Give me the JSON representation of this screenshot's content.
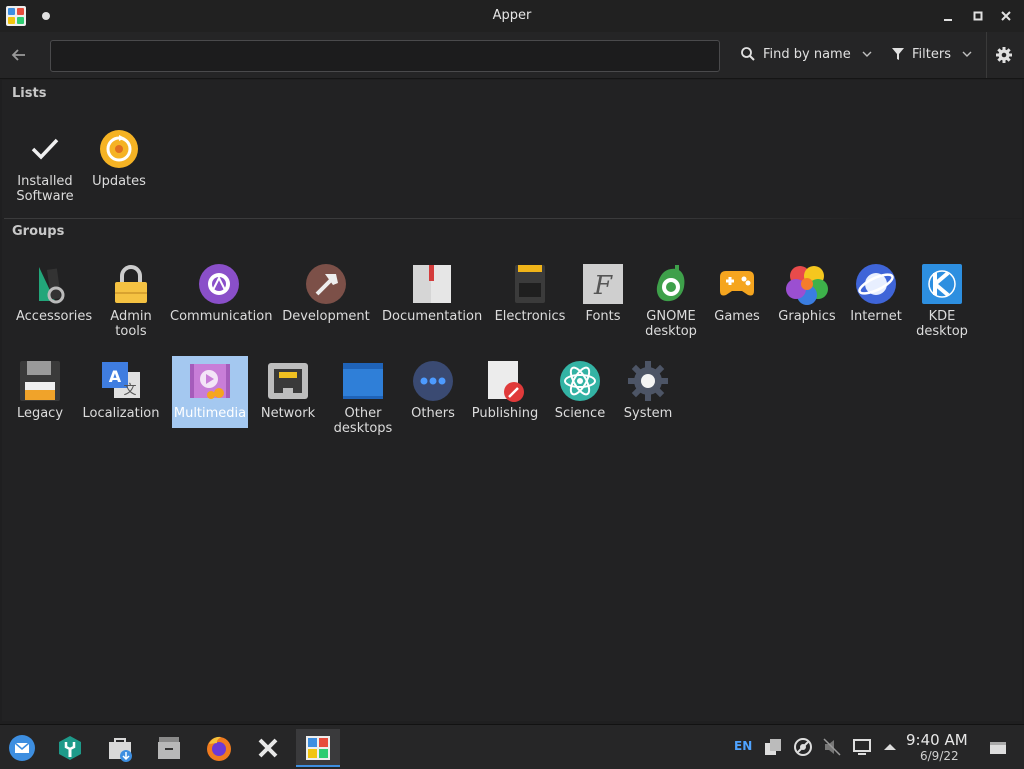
{
  "window": {
    "title": "Apper"
  },
  "toolbar": {
    "search_value": "",
    "find_by_label": "Find by name",
    "filters_label": "Filters"
  },
  "lists": {
    "title": "Lists",
    "items": [
      {
        "label": "Installed\nSoftware",
        "icon": "checkmark-icon"
      },
      {
        "label": "Updates",
        "icon": "updates-icon"
      }
    ]
  },
  "groups": {
    "title": "Groups",
    "items": [
      {
        "label": "Accessories",
        "icon": "accessories-icon"
      },
      {
        "label": "Admin\ntools",
        "icon": "lock-icon"
      },
      {
        "label": "Communication",
        "icon": "communication-icon"
      },
      {
        "label": "Development",
        "icon": "hammer-icon"
      },
      {
        "label": "Documentation",
        "icon": "book-icon"
      },
      {
        "label": "Electronics",
        "icon": "memory-card-icon"
      },
      {
        "label": "Fonts",
        "icon": "fonts-icon"
      },
      {
        "label": "GNOME\ndesktop",
        "icon": "gnome-icon"
      },
      {
        "label": "Games",
        "icon": "gamepad-icon"
      },
      {
        "label": "Graphics",
        "icon": "graphics-icon"
      },
      {
        "label": "Internet",
        "icon": "internet-icon"
      },
      {
        "label": "KDE\ndesktop",
        "icon": "kde-icon"
      },
      {
        "label": "Legacy",
        "icon": "floppy-icon"
      },
      {
        "label": "Localization",
        "icon": "translate-icon"
      },
      {
        "label": "Multimedia",
        "icon": "multimedia-icon"
      },
      {
        "label": "Network",
        "icon": "network-port-icon"
      },
      {
        "label": "Other\ndesktops",
        "icon": "monitor-icon"
      },
      {
        "label": "Others",
        "icon": "more-icon"
      },
      {
        "label": "Publishing",
        "icon": "publishing-icon"
      },
      {
        "label": "Science",
        "icon": "atom-icon"
      },
      {
        "label": "System",
        "icon": "system-gear-icon"
      }
    ],
    "selected": "Multimedia"
  },
  "taskbar": {
    "apps": [
      "mail-icon",
      "settings-wrench-icon",
      "software-store-icon",
      "file-archive-icon",
      "firefox-icon",
      "system-tools-icon",
      "apper-icon"
    ],
    "active": "apper-icon",
    "tray": {
      "language": "EN",
      "time": "9:40 AM",
      "date": "6/9/22"
    }
  },
  "colors": {
    "accent": "#3d8ee0",
    "selection": "#a4c8f0",
    "background": "#222223"
  }
}
